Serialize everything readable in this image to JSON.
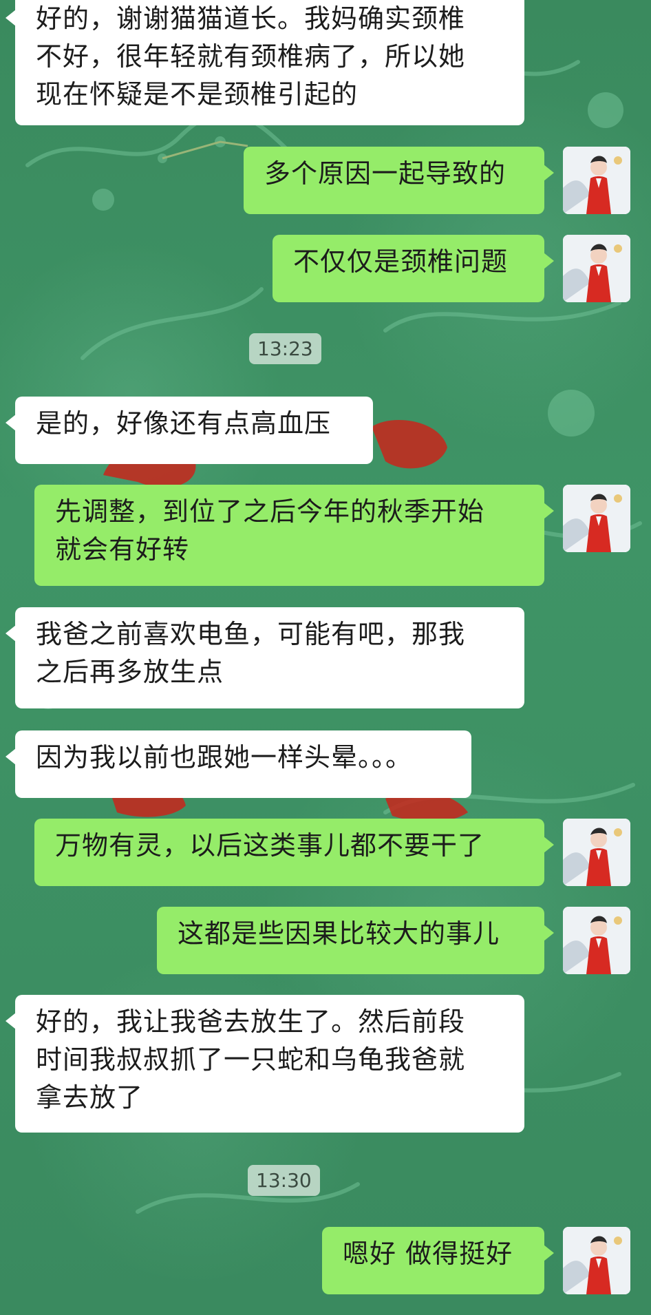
{
  "chat": {
    "messages": [
      {
        "side": "in",
        "text": "好的，谢谢猫猫道长。我妈确实颈椎\n不好，很年轻就有颈椎病了，所以她\n现在怀疑是不是颈椎引起的"
      },
      {
        "side": "out",
        "text": "多个原因一起导致的"
      },
      {
        "side": "out",
        "text": "不仅仅是颈椎问题"
      },
      {
        "side": "in",
        "text": "是的，好像还有点高血压"
      },
      {
        "side": "out",
        "text": "先调整，到位了之后今年的秋季开始\n就会有好转"
      },
      {
        "side": "in",
        "text": "我爸之前喜欢电鱼，可能有吧，那我\n之后再多放生点"
      },
      {
        "side": "in",
        "text": "因为我以前也跟她一样头晕。。。"
      },
      {
        "side": "out",
        "text": "万物有灵，以后这类事儿都不要干了"
      },
      {
        "side": "out",
        "text": "这都是些因果比较大的事儿"
      },
      {
        "side": "in",
        "text": "好的，我让我爸去放生了。然后前段\n时间我叔叔抓了一只蛇和乌龟我爸就\n拿去放了"
      },
      {
        "side": "out",
        "text": "嗯好 做得挺好"
      }
    ],
    "timestamps": [
      "13:23",
      "13:30"
    ]
  },
  "theme": {
    "incoming_bubble": "#ffffff",
    "outgoing_bubble": "#95ec69",
    "background": "#3e8f63"
  },
  "avatar_icon": "avatar-woman-red-robe-icon"
}
